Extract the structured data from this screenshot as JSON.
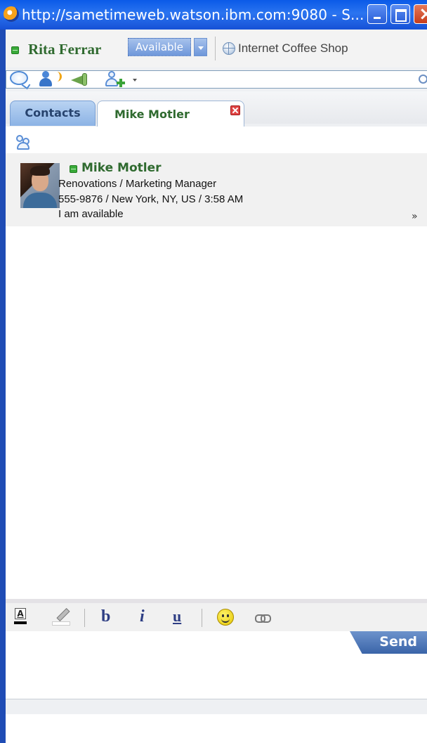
{
  "window": {
    "title": "http://sametimeweb.watson.ibm.com:9080 - S..."
  },
  "status": {
    "user_name": "Rita Ferrar",
    "availability": "Available",
    "location": "Internet Coffee Shop"
  },
  "search": {
    "value": "",
    "placeholder": ""
  },
  "toolbar": {
    "icons": [
      "chat-icon",
      "call-icon",
      "announce-icon",
      "add-contact-icon"
    ]
  },
  "tabs": [
    {
      "label": "Contacts"
    },
    {
      "label": "Mike Motler"
    }
  ],
  "contact": {
    "name": "Mike Motler",
    "title": "Renovations / Marketing Manager",
    "phone_location_time": "555-9876 / New York, NY, US / 3:58 AM",
    "status_message": "I am available",
    "expand": "»",
    "status_color": "#3aaa3a"
  },
  "format_toolbar": {
    "bold": "b",
    "italic": "i",
    "underline": "u",
    "font_color_letter": "A"
  },
  "compose": {
    "send_label": "Send",
    "value": ""
  },
  "colors": {
    "titlebar": "#0a5ae8",
    "accent_blue": "#6d93cc",
    "online_green": "#2f6a2f"
  }
}
